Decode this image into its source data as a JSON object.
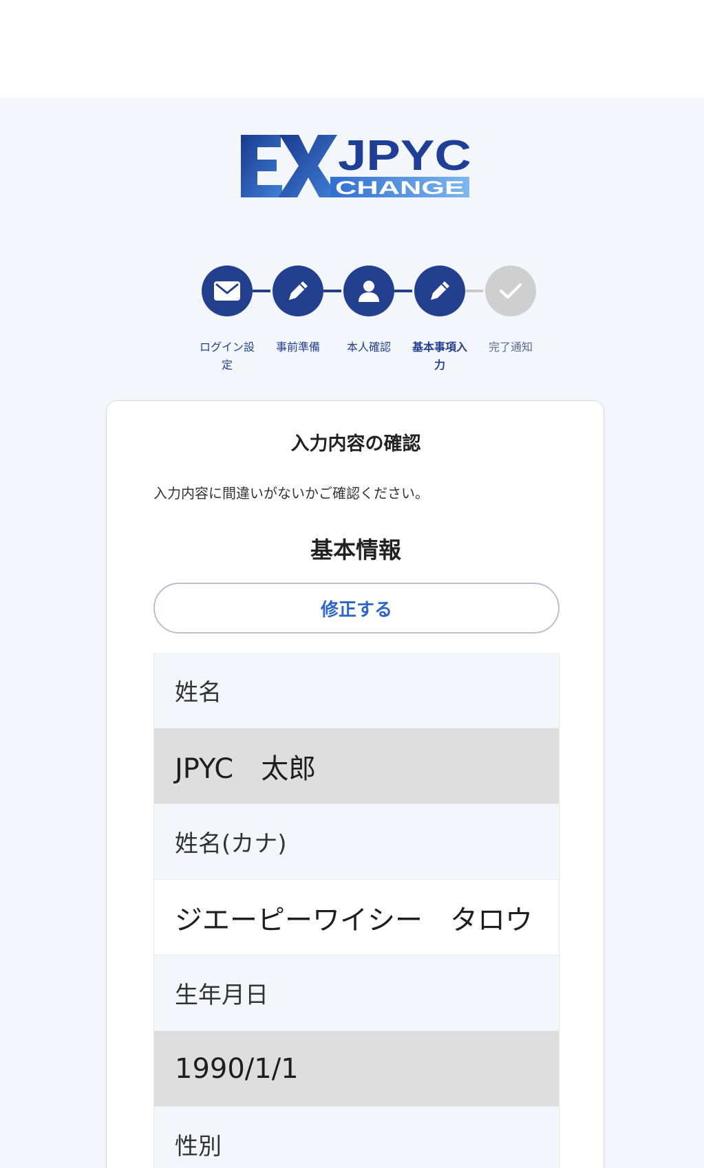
{
  "brand": {
    "logo_ex": "EX",
    "logo_jpyc": "JPYC",
    "logo_change": "CHANGE",
    "primary_color": "#23408e",
    "accent_color": "#2d66c4"
  },
  "stepper": {
    "steps": [
      {
        "label": "ログイン設定",
        "icon": "envelope-icon",
        "state": "done"
      },
      {
        "label": "事前準備",
        "icon": "pencil-icon",
        "state": "done"
      },
      {
        "label": "本人確認",
        "icon": "person-icon",
        "state": "done"
      },
      {
        "label": "基本事項入力",
        "icon": "pencil-icon",
        "state": "current"
      },
      {
        "label": "完了通知",
        "icon": "check-icon",
        "state": "pending"
      }
    ]
  },
  "card": {
    "title": "入力内容の確認",
    "description": "入力内容に間違いがないかご確認ください。",
    "section_title": "基本情報",
    "edit_label": "修正する",
    "fields": [
      {
        "label": "姓名",
        "value": "JPYC　太郎"
      },
      {
        "label": "姓名(カナ)",
        "value": "ジエーピーワイシー　タロウ"
      },
      {
        "label": "生年月日",
        "value": "1990/1/1"
      },
      {
        "label": "性別",
        "value": ""
      }
    ]
  }
}
